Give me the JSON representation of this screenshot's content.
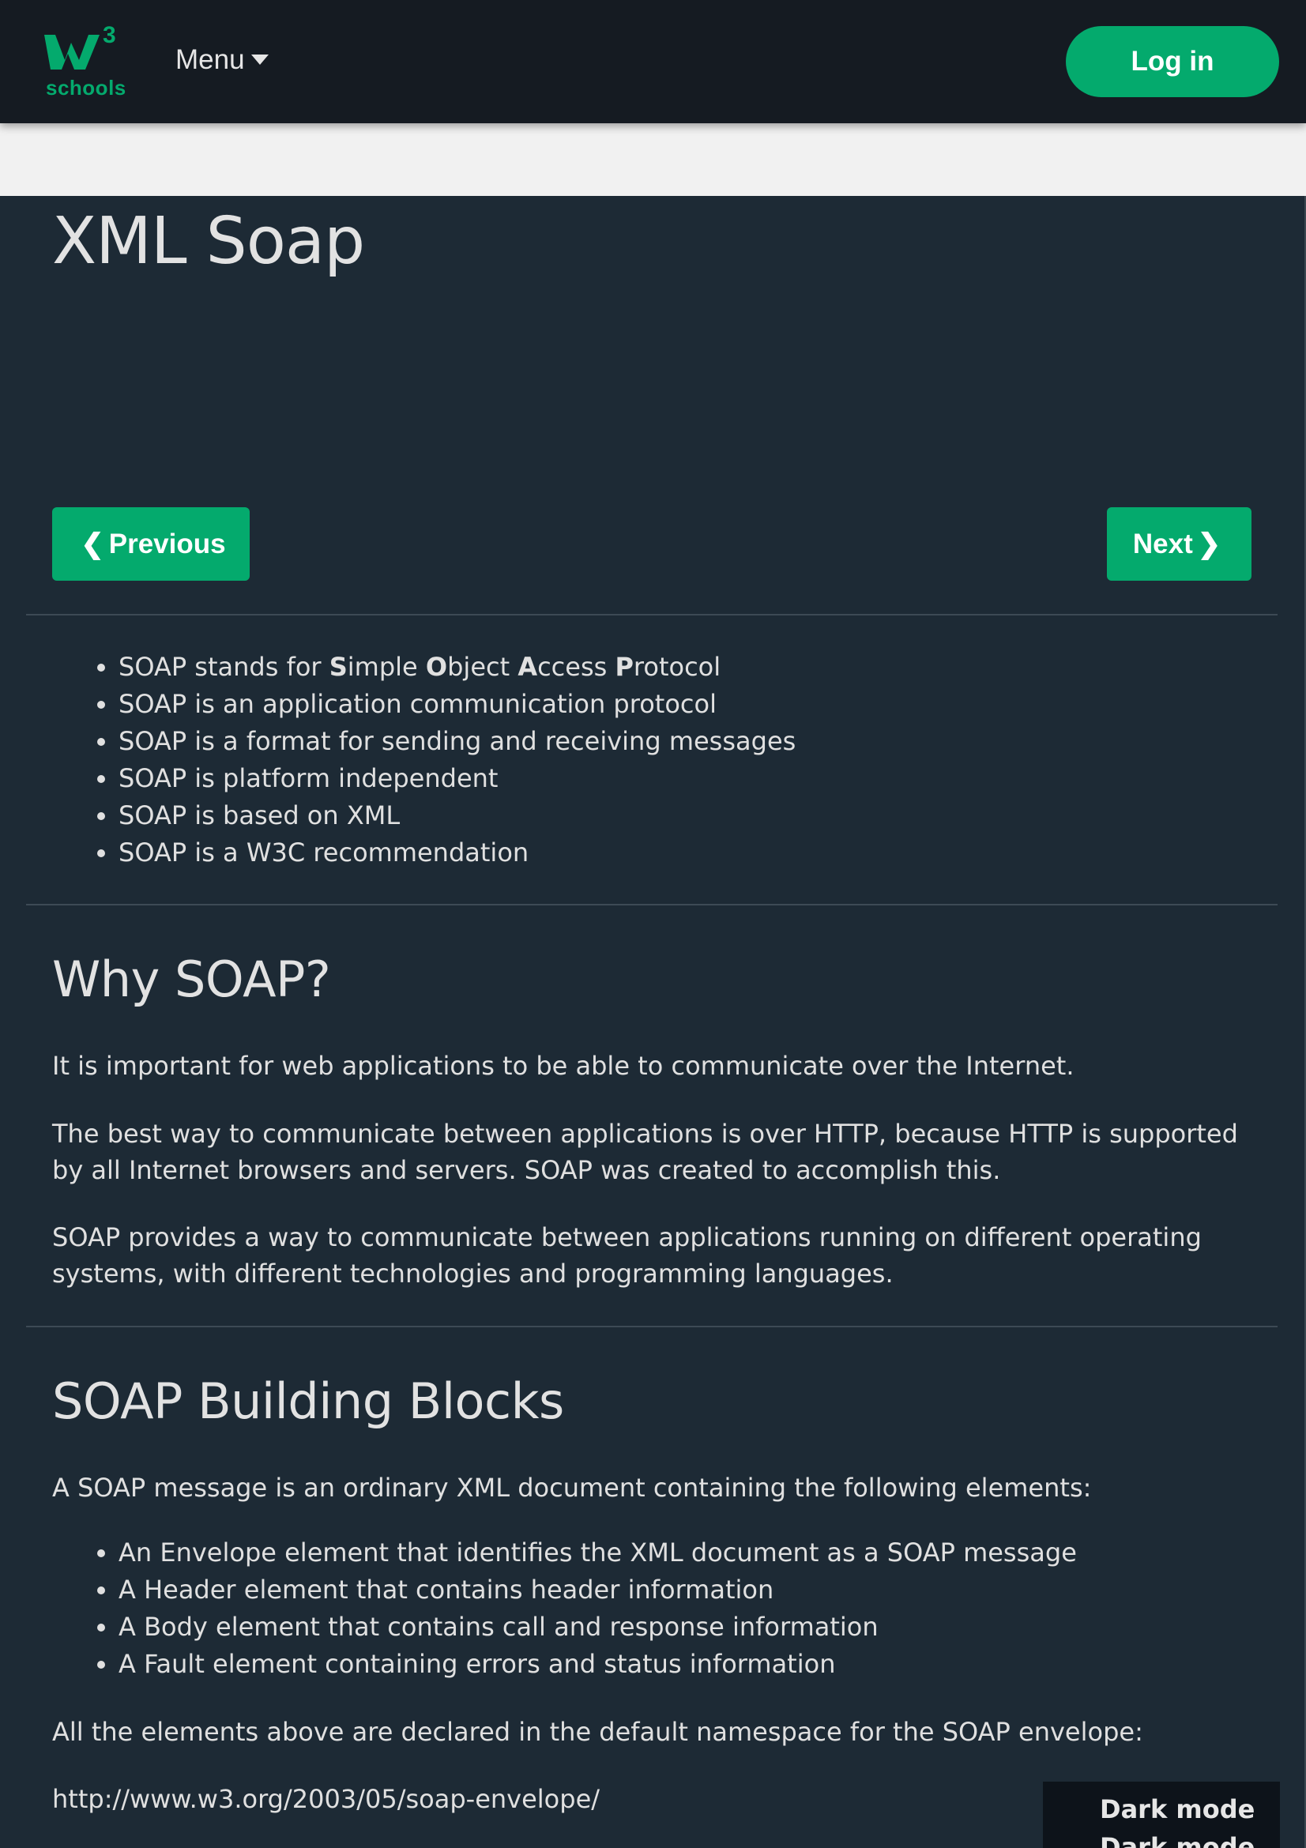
{
  "header": {
    "logo_text": "schools",
    "logo_sup": "3",
    "menu_label": "Menu",
    "login_label": "Log in"
  },
  "page": {
    "title": "XML Soap",
    "prev_label": "Previous",
    "next_label": "Next"
  },
  "intro_list": {
    "first_item": {
      "prefix": "SOAP stands for ",
      "parts": [
        {
          "bold": "S",
          "rest": "imple "
        },
        {
          "bold": "O",
          "rest": "bject "
        },
        {
          "bold": "A",
          "rest": "ccess "
        },
        {
          "bold": "P",
          "rest": "rotocol"
        }
      ]
    },
    "items": [
      "SOAP is an application communication protocol",
      "SOAP is a format for sending and receiving messages",
      "SOAP is platform independent",
      "SOAP is based on XML",
      "SOAP is a W3C recommendation"
    ]
  },
  "why_soap": {
    "heading": "Why SOAP?",
    "paragraphs": [
      "It is important for web applications to be able to communicate over the Internet.",
      "The best way to communicate between applications is over HTTP, because HTTP is supported by all Internet browsers and servers. SOAP was created to accomplish this.",
      "SOAP provides a way to communicate between applications running on different operating systems, with different technologies and programming languages."
    ]
  },
  "building_blocks": {
    "heading": "SOAP Building Blocks",
    "intro": "A SOAP message is an ordinary XML document containing the following elements:",
    "items": [
      "An Envelope element that identifies the XML document as a SOAP message",
      "A Header element that contains header information",
      "A Body element that contains call and response information",
      "A Fault element containing errors and status information"
    ],
    "namespace_note": "All the elements above are declared in the default namespace for the SOAP envelope:",
    "namespace_url": "http://www.w3.org/2003/05/soap-envelope/"
  },
  "dark_mode": {
    "label": "Dark mode",
    "label_repeat": "Dark mode"
  },
  "colors": {
    "accent": "#04aa6d",
    "background": "#1d2a35",
    "topbar": "#151b22"
  }
}
